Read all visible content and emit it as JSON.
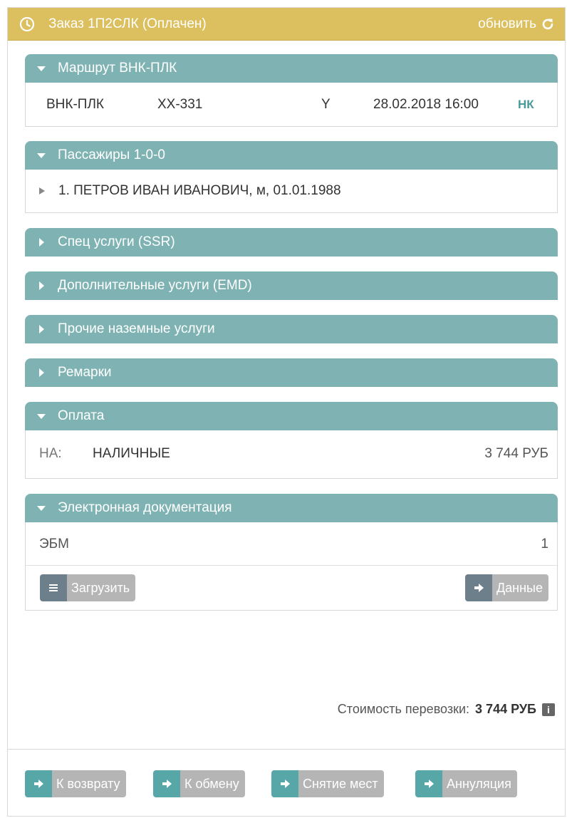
{
  "header": {
    "title": "Заказ 1П2СЛК (Оплачен)",
    "refresh_label": "обновить",
    "accent": "#dcbf5e"
  },
  "route": {
    "title": "Маршрут ВНК-ПЛК",
    "segment": {
      "route": "ВНК-ПЛК",
      "flight": "XX-331",
      "class": "Y",
      "datetime": "28.02.2018 16:00",
      "status": "НК"
    }
  },
  "passengers": {
    "title": "Пассажиры 1-0-0",
    "items": [
      "1. ПЕТРОВ ИВАН ИВАНОВИЧ, м, 01.01.1988"
    ]
  },
  "sections": {
    "ssr": "Спец услуги (SSR)",
    "emd": "Дополнительные услуги (EMD)",
    "ground": "Прочие наземные услуги",
    "remarks": "Ремарки"
  },
  "payment": {
    "title": "Оплата",
    "code": "НА:",
    "method": "НАЛИЧНЫЕ",
    "amount": "3 744 РУБ"
  },
  "documents": {
    "title": "Электронная документация",
    "type": "ЭБМ",
    "count": "1",
    "upload_label": "Загрузить",
    "data_label": "Данные"
  },
  "total": {
    "label": "Стоимость перевозки:",
    "value": "3 744 РУБ"
  },
  "actions": {
    "refund": "К возврату",
    "exchange": "К обмену",
    "seats": "Снятие мест",
    "cancel": "Аннуляция"
  },
  "colors": {
    "panel_header": "#7fb3b3",
    "button_icon": "#57a7a8",
    "button_label": "#b5b5b5"
  }
}
